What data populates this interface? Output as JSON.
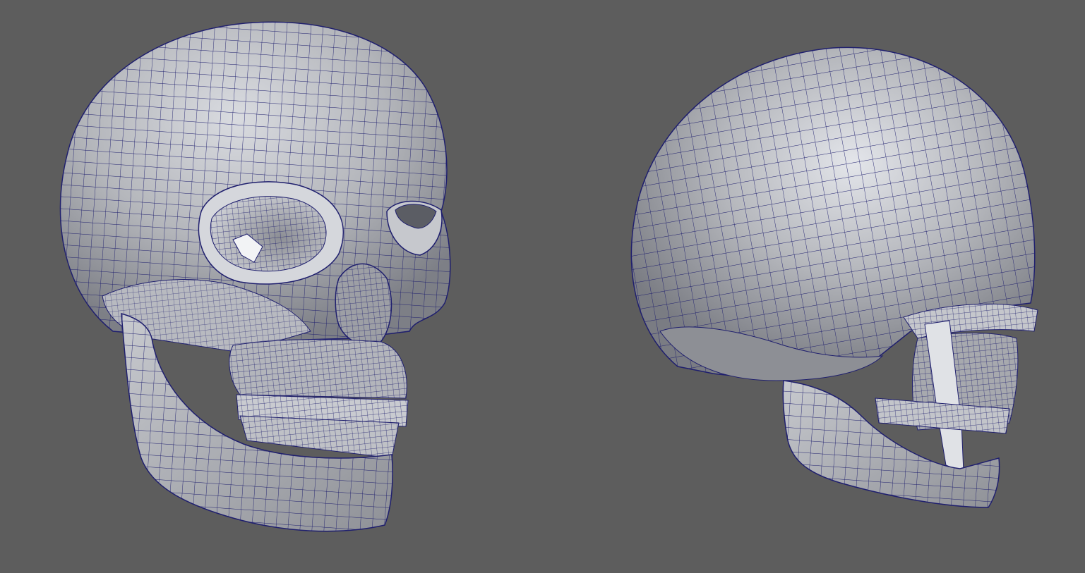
{
  "viewport": {
    "background_color": "#5d5d5d",
    "wire_color": "#1f1f6e",
    "surface_color": "#a9abb0",
    "highlight_color": "#e4e6ea",
    "shadow_color": "#6f7076"
  },
  "models": [
    {
      "name": "skull-front-three-quarter-view",
      "icon": "wireframe-skull"
    },
    {
      "name": "skull-rear-three-quarter-view",
      "icon": "wireframe-skull"
    }
  ]
}
